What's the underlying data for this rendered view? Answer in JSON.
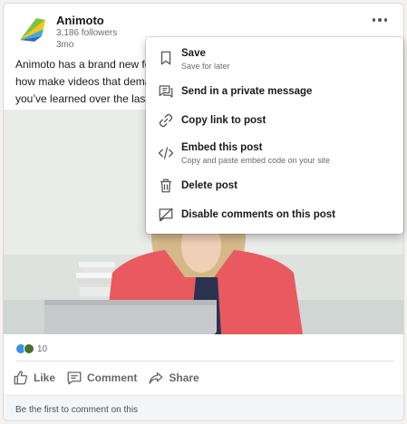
{
  "post": {
    "company_name": "Animoto",
    "followers": "3,186 followers",
    "time": "3mo",
    "text_lines": [
      "Animoto has a brand new fe",
      "how make videos that dema",
      "you’ve learned over the last"
    ],
    "reaction_count": "10"
  },
  "actions": {
    "like": "Like",
    "comment": "Comment",
    "share": "Share"
  },
  "comment_prompt": "Be the first to comment on this",
  "menu": {
    "items": [
      {
        "title": "Save",
        "subtitle": "Save for later",
        "icon": "bookmark-icon"
      },
      {
        "title": "Send in a private message",
        "icon": "message-icon"
      },
      {
        "title": "Copy link to post",
        "icon": "link-icon"
      },
      {
        "title": "Embed this post",
        "subtitle": "Copy and paste embed code on your site",
        "icon": "code-icon"
      },
      {
        "title": "Delete post",
        "icon": "trash-icon"
      },
      {
        "title": "Disable comments on this post",
        "icon": "comment-off-icon"
      }
    ]
  },
  "colors": {
    "like_blue": "#378fe9",
    "celebrate_green": "#44712e",
    "shirt_coral": "#e85a5f"
  }
}
